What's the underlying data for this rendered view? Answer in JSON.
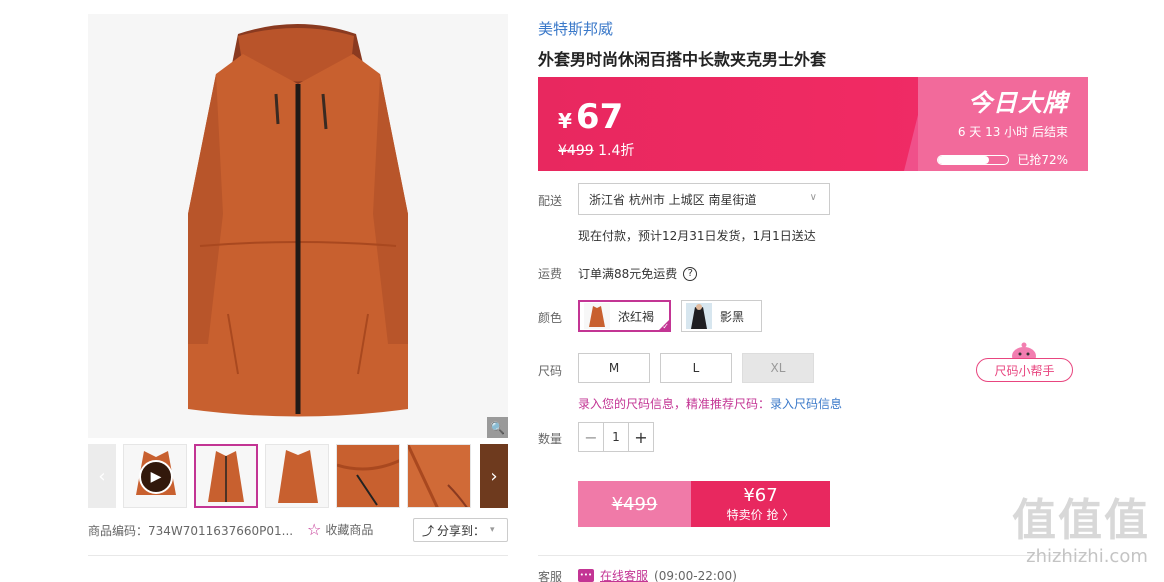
{
  "brand": "美特斯邦威",
  "title": "外套男时尚休闲百搭中长款夹克男士外套",
  "price": {
    "currency": "¥",
    "current": "67",
    "original": "¥499",
    "discount": "1.4折",
    "promo_title": "今日大牌",
    "countdown": "6 天 13 小时 后结束",
    "sold_label": "已抢72%",
    "sold_fraction": 0.72
  },
  "delivery": {
    "label": "配送",
    "address": "浙江省 杭州市 上城区 南星街道",
    "note": "现在付款，预计12月31日发货，1月1日送达"
  },
  "freight": {
    "label": "运费",
    "text": "订单满88元免运费",
    "help": "?"
  },
  "colors": {
    "label": "颜色",
    "options": [
      {
        "name": "浓红褐",
        "selected": true
      },
      {
        "name": "影黑",
        "selected": false
      }
    ]
  },
  "sizes": {
    "label": "尺码",
    "options": [
      {
        "name": "M",
        "available": true
      },
      {
        "name": "L",
        "available": true
      },
      {
        "name": "XL",
        "available": false
      }
    ],
    "helper": "尺码小帮手",
    "tip_prefix": "录入您的尺码信息，精准推荐尺码：",
    "tip_link": "录入尺码信息"
  },
  "quantity": {
    "label": "数量",
    "value": "1",
    "minus": "−",
    "plus": "+"
  },
  "buy": {
    "original": "¥499",
    "price": "¥67",
    "action": "特卖价 抢 〉"
  },
  "service": {
    "label": "客服",
    "link": "在线客服",
    "hours": "(09:00-22:00)"
  },
  "gallery": {
    "sku_code": "商品编码：734W7011637660P01...",
    "favorite": "收藏商品",
    "share": "分享到："
  },
  "watermark": {
    "big": "值值值",
    "small": "zhizhizhi.com"
  },
  "colors_theme": {
    "accent": "#c33594",
    "promo": "#e8285f",
    "link": "#3b79c9",
    "jacket": "#c8602f"
  }
}
